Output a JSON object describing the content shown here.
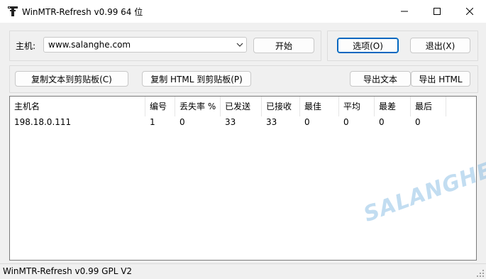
{
  "window": {
    "title": "WinMTR-Refresh v0.99 64 位",
    "icon": "app-icon",
    "controls": [
      "minimize-icon",
      "maximize-icon",
      "close-icon"
    ]
  },
  "host": {
    "label": "主机:",
    "value": "www.salanghe.com"
  },
  "buttons": {
    "start": "开始",
    "options": "选项(O)",
    "exit": "退出(X)",
    "copy_text": "复制文本到剪贴板(C)",
    "copy_html": "复制 HTML 到剪贴板(P)",
    "export_text": "导出文本",
    "export_html": "导出 HTML"
  },
  "table": {
    "columns": [
      "主机名",
      "编号",
      "丢失率 %",
      "已发送",
      "已接收",
      "最佳",
      "平均",
      "最差",
      "最后"
    ],
    "rows": [
      [
        "198.18.0.111",
        "1",
        "0",
        "33",
        "33",
        "0",
        "0",
        "0",
        "0"
      ]
    ]
  },
  "watermark": "SALANGHE",
  "status": {
    "text": "WinMTR-Refresh v0.99 GPL V2"
  },
  "colors": {
    "accent": "#0067c0",
    "window_bg": "#f0f0f0",
    "watermark": "#78b4e1"
  }
}
